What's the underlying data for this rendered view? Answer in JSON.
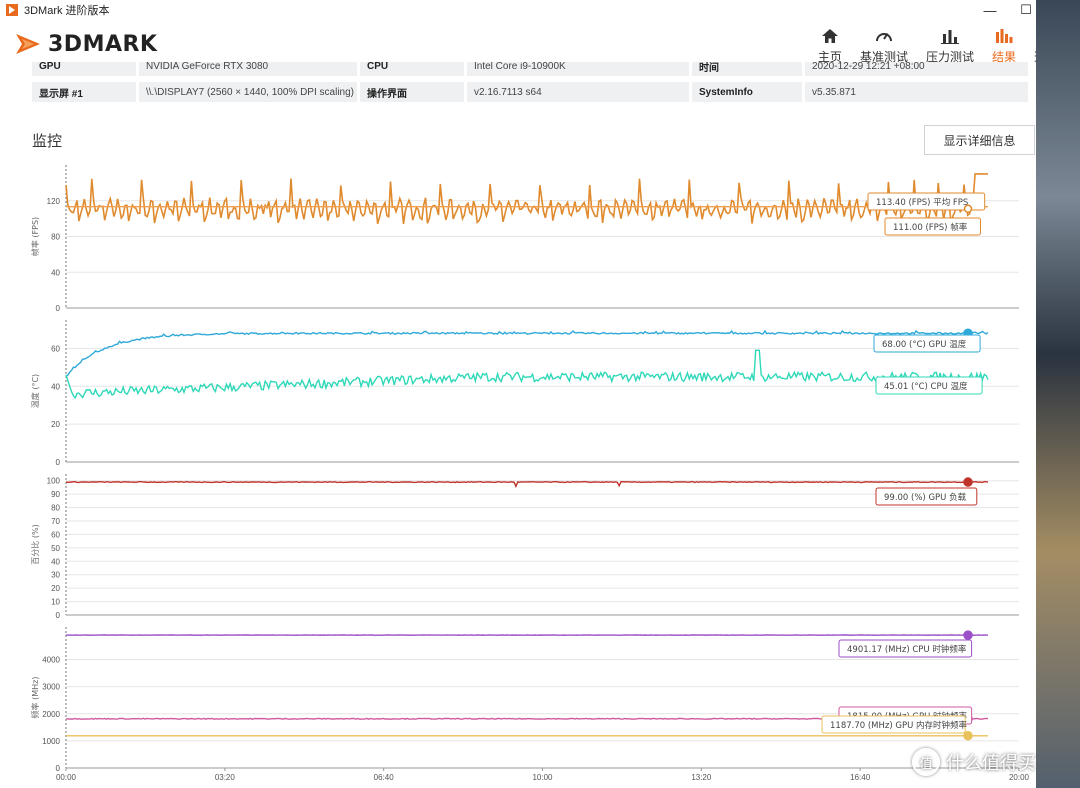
{
  "window": {
    "title": "3DMark 进阶版本",
    "minimize": "—",
    "maximize": "☐",
    "close": "✕"
  },
  "logo": {
    "text": "3DMARK"
  },
  "nav": [
    {
      "label": "主页",
      "icon": "home-icon"
    },
    {
      "label": "基准测试",
      "icon": "gauge-icon"
    },
    {
      "label": "压力测试",
      "icon": "bars-icon"
    },
    {
      "label": "结果",
      "icon": "results-icon",
      "active": true
    },
    {
      "label": "选项",
      "icon": "gear-icon"
    }
  ],
  "colors": {
    "accent": "#e86a1f",
    "fps": "#e08a2e",
    "fps_avg": "#f0a050",
    "gpu_temp": "#2ea9d9",
    "cpu_temp": "#2fd8b8",
    "gpu_load": "#c0332b",
    "cpu_clock": "#9b4fc8",
    "gpu_clock": "#d05aa0",
    "mem_clock": "#e8c15a"
  },
  "system_info": {
    "row1": [
      {
        "k": "GPU",
        "v": "NVIDIA GeForce RTX 3080"
      },
      {
        "k": "CPU",
        "v": "Intel Core i9-10900K"
      },
      {
        "k": "时间",
        "v": "2020-12-29 12:21 +08:00"
      }
    ],
    "row2": [
      {
        "k": "显示屏 #1",
        "v": "\\\\.\\DISPLAY7 (2560 × 1440, 100% DPI scaling)"
      },
      {
        "k": "操作界面",
        "v": "v2.16.7113 s64"
      },
      {
        "k": "SystemInfo",
        "v": "v5.35.871"
      }
    ]
  },
  "monitor": {
    "title": "监控",
    "detail_button": "显示详细信息"
  },
  "watermark": {
    "text": "什么值得买",
    "mark": "值"
  },
  "chart_data": [
    {
      "type": "line",
      "ylabel": "帧率 (FPS)",
      "yticks": [
        0,
        40,
        80,
        120
      ],
      "ylim": [
        0,
        160
      ],
      "series": [
        {
          "name": "帧率",
          "color": "#e08a2e",
          "pattern": "spiky",
          "base": 111,
          "noise": 12,
          "spikes": 37,
          "spike_height": 145,
          "end": 150
        },
        {
          "name": "平均 FPS",
          "color": "#f0a050",
          "constant": 113.4
        }
      ],
      "labels": [
        {
          "text": "113.40 (FPS) 平均 FPS",
          "value": 113.4,
          "color": "#e08a2e"
        },
        {
          "text": "111.00 (FPS) 帧率",
          "value": 111,
          "color": "#e08a2e"
        }
      ]
    },
    {
      "type": "line",
      "ylabel": "温度 (°C)",
      "yticks": [
        0,
        20,
        40,
        60
      ],
      "ylim": [
        0,
        75
      ],
      "series": [
        {
          "name": "GPU 温度",
          "color": "#2ea9d9",
          "pattern": "warmup",
          "start": 45,
          "end": 68,
          "noise": 0.4
        },
        {
          "name": "CPU 温度",
          "color": "#2fd8b8",
          "pattern": "noisy_rise",
          "start": 36,
          "end": 45,
          "noise": 2.5,
          "bump_at": 0.75,
          "bump": 59
        }
      ],
      "labels": [
        {
          "text": "68.00 (°C) GPU 温度",
          "value": 68,
          "color": "#2ea9d9"
        },
        {
          "text": "45.01 (°C) CPU 温度",
          "value": 45,
          "color": "#2fd8b8"
        }
      ]
    },
    {
      "type": "line",
      "ylabel": "百分比 (%)",
      "yticks": [
        0,
        10,
        20,
        30,
        40,
        50,
        60,
        70,
        80,
        90,
        100
      ],
      "ylim": [
        0,
        105
      ],
      "series": [
        {
          "name": "GPU 负载",
          "color": "#c0332b",
          "pattern": "flat",
          "value": 99,
          "noise": 0.3
        }
      ],
      "labels": [
        {
          "text": "99.00 (%) GPU 负载",
          "value": 99,
          "color": "#c0332b"
        }
      ]
    },
    {
      "type": "line",
      "ylabel": "频率 (MHz)",
      "yticks": [
        0,
        1000,
        2000,
        3000,
        4000
      ],
      "ylim": [
        0,
        5200
      ],
      "xticks": [
        "00:00",
        "03:20",
        "06:40",
        "10:00",
        "13:20",
        "16:40",
        "20:00"
      ],
      "xlim": [
        0,
        1200
      ],
      "series": [
        {
          "name": "CPU 时钟频率",
          "color": "#9b4fc8",
          "pattern": "flat",
          "value": 4901.17,
          "noise": 5
        },
        {
          "name": "GPU 时钟频率",
          "color": "#d05aa0",
          "pattern": "flat",
          "value": 1815,
          "noise": 15
        },
        {
          "name": "GPU 内存时钟频率",
          "color": "#e8c15a",
          "pattern": "flat",
          "value": 1187.7,
          "noise": 0
        }
      ],
      "labels": [
        {
          "text": "4901.17 (MHz) CPU 时钟频率",
          "value": 4901.17,
          "color": "#9b4fc8"
        },
        {
          "text": "1815.00 (MHz) GPU 时钟频率",
          "value": 1815,
          "color": "#d05aa0"
        },
        {
          "text": "1187.70 (MHz) GPU 内存时钟频率",
          "value": 1187.7,
          "color": "#e8c15a"
        }
      ]
    }
  ]
}
